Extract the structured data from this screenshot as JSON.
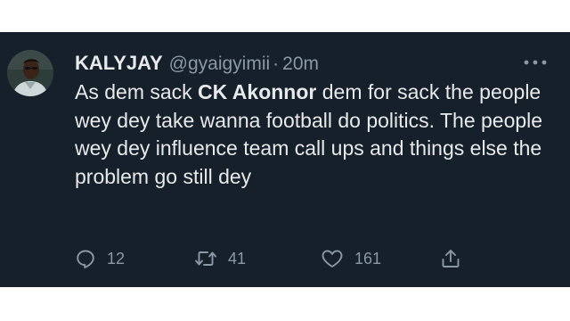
{
  "tweet": {
    "author": {
      "name": "KALYJAY",
      "handle": "@gyaigyimii",
      "separator": "·",
      "time": "20m"
    },
    "text": {
      "before": "As dem sack ",
      "bold": "CK Akonnor",
      "after": " dem for sack the people wey dey take wanna football do politics. The people wey dey influence team call ups and things else the problem go still dey"
    },
    "actions": {
      "reply": {
        "icon": "reply-icon",
        "count": "12"
      },
      "retweet": {
        "icon": "retweet-icon",
        "count": "41"
      },
      "like": {
        "icon": "heart-icon",
        "count": "161"
      },
      "share": {
        "icon": "share-icon"
      }
    },
    "more_icon": "more-dots-icon"
  },
  "colors": {
    "card_background": "#15202b",
    "text_primary": "#e7e9ea",
    "text_secondary": "#8b98a5",
    "page_background": "#ffffff"
  }
}
